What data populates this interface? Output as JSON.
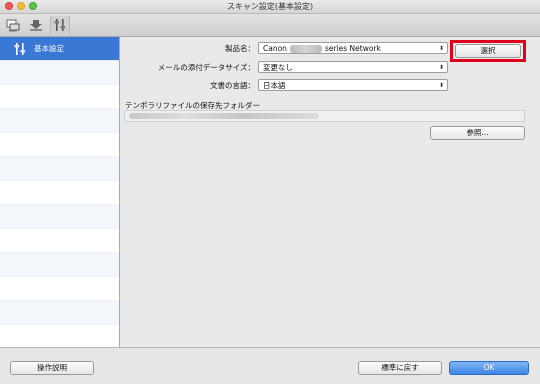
{
  "window": {
    "title": "スキャン設定(基本設定)"
  },
  "toolbar": {
    "icons": [
      "scan-from-pc-icon",
      "scan-from-panel-icon",
      "general-settings-icon"
    ]
  },
  "sidebar": {
    "items": [
      {
        "label": "基本設定",
        "icon": "settings-sliders-icon",
        "selected": true
      }
    ]
  },
  "form": {
    "product_label": "製品名：",
    "product_value_prefix": "Canon",
    "product_value_suffix": "series Network",
    "select_button": "選択",
    "attachment_label": "メールの添付データサイズ：",
    "attachment_value": "変更なし",
    "language_label": "文書の言語：",
    "language_value": "日本語",
    "temp_folder_label": "テンポラリファイルの保存先フォルダー",
    "browse_button": "参照..."
  },
  "bottom": {
    "help_button": "操作説明",
    "defaults_button": "標準に戻す",
    "ok_button": "OK"
  },
  "colors": {
    "highlight": "#e0001b",
    "selection": "#3a78d6",
    "ok": "#3c86e6"
  }
}
